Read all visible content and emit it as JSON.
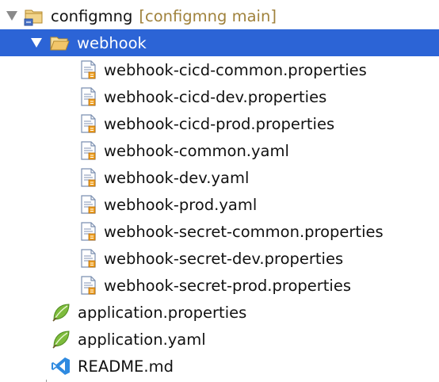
{
  "tree": {
    "root": {
      "label": "configmng",
      "repo": "[configmng main]",
      "icon": "project-folder-icon"
    },
    "folder": {
      "label": "webhook",
      "icon": "open-folder-icon"
    },
    "files": [
      {
        "label": "webhook-cicd-common.properties",
        "icon": "properties-file-icon"
      },
      {
        "label": "webhook-cicd-dev.properties",
        "icon": "properties-file-icon"
      },
      {
        "label": "webhook-cicd-prod.properties",
        "icon": "properties-file-icon"
      },
      {
        "label": "webhook-common.yaml",
        "icon": "yaml-file-icon"
      },
      {
        "label": "webhook-dev.yaml",
        "icon": "yaml-file-icon"
      },
      {
        "label": "webhook-prod.yaml",
        "icon": "yaml-file-icon"
      },
      {
        "label": "webhook-secret-common.properties",
        "icon": "properties-file-icon"
      },
      {
        "label": "webhook-secret-dev.properties",
        "icon": "properties-file-icon"
      },
      {
        "label": "webhook-secret-prod.properties",
        "icon": "properties-file-icon"
      }
    ],
    "root_files": [
      {
        "label": "application.properties",
        "icon": "spring-leaf-icon"
      },
      {
        "label": "application.yaml",
        "icon": "spring-leaf-icon"
      },
      {
        "label": "README.md",
        "icon": "vscode-icon"
      }
    ]
  },
  "colors": {
    "selection": "#2c64d6",
    "repo_label": "#a0823c"
  }
}
